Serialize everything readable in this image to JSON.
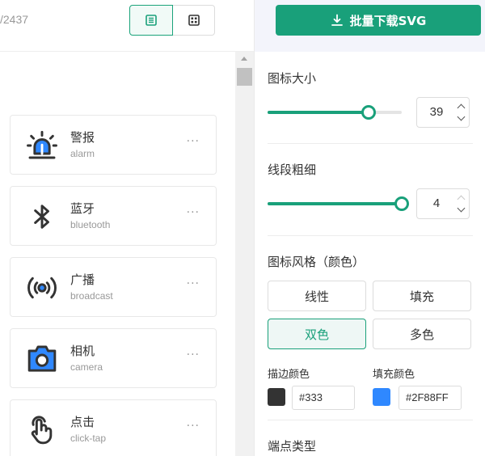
{
  "header": {
    "count_text": "/2437",
    "view_toggle": {
      "active": "list"
    }
  },
  "icons": [
    {
      "zh": "警报",
      "en": "alarm",
      "icon": "alarm-icon",
      "more": "···"
    },
    {
      "zh": "蓝牙",
      "en": "bluetooth",
      "icon": "bluetooth-icon",
      "more": "···"
    },
    {
      "zh": "广播",
      "en": "broadcast",
      "icon": "broadcast-icon",
      "more": "···"
    },
    {
      "zh": "相机",
      "en": "camera",
      "icon": "camera-icon",
      "more": "···"
    },
    {
      "zh": "点击",
      "en": "click-tap",
      "icon": "click-tap-icon",
      "more": "···"
    }
  ],
  "panel": {
    "download_label": "批量下载SVG",
    "size": {
      "title": "图标大小",
      "value": "39",
      "fraction": 0.75
    },
    "stroke": {
      "title": "线段粗细",
      "value": "4",
      "fraction": 1.0
    },
    "style": {
      "title": "图标风格（颜色）",
      "options": [
        "线性",
        "填充",
        "双色",
        "多色"
      ],
      "active": "双色"
    },
    "stroke_color": {
      "label": "描边颜色",
      "value": "#333",
      "hex": "#333333"
    },
    "fill_color": {
      "label": "填充颜色",
      "value": "#2F88FF",
      "hex": "#2F88FF"
    },
    "endpoint_title": "端点类型"
  },
  "colors": {
    "accent": "#19a07a",
    "icon_fill": "#2F88FF",
    "icon_stroke": "#333333"
  }
}
